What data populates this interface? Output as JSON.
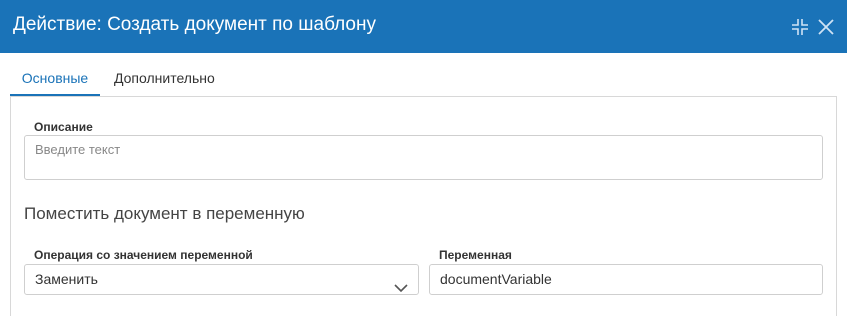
{
  "window": {
    "title": "Действие: Создать документ по шаблону"
  },
  "tabs": [
    {
      "label": "Основные",
      "active": true
    },
    {
      "label": "Дополнительно",
      "active": false
    }
  ],
  "description": {
    "label": "Описание",
    "placeholder": "Введите текст",
    "value": ""
  },
  "section": {
    "title": "Поместить документ в переменную"
  },
  "operation": {
    "label": "Операция со значением переменной",
    "value": "Заменить"
  },
  "variable": {
    "label": "Переменная",
    "value": "documentVariable"
  },
  "colors": {
    "accent": "#1a73b8"
  },
  "icons": {
    "collapse": "collapse-icon",
    "close": "close-icon",
    "dropdown": "chevron-down-icon"
  }
}
